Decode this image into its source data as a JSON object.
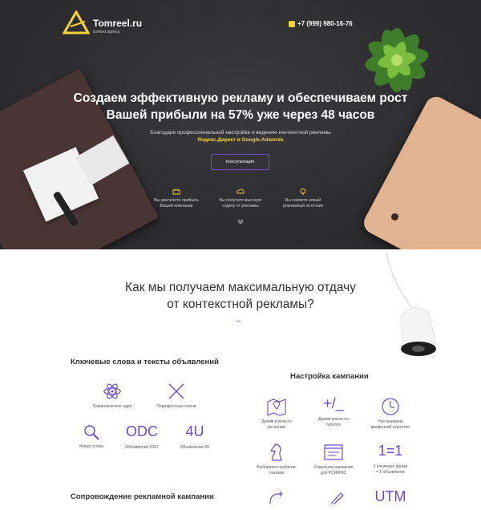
{
  "header": {
    "brand": "Tomreel.ru",
    "brand_sub": "context agency",
    "phone": "+7 (999) 980-16-76"
  },
  "hero": {
    "title_line1": "Создаем эффективную рекламу и обеспечиваем рост",
    "title_line2": "Вашей прибыли на 57% уже через 48 часов",
    "subtitle": "Благодаря профессиональной настройке и ведению контекстной рекламы",
    "subtitle_accent": "Яндекс.Директ и Google.Adwords",
    "cta_label": "Консультация",
    "features": [
      {
        "l1": "Вы увеличите прибыль",
        "l2": "Вашей компании"
      },
      {
        "l1": "Вы получите высокую",
        "l2": "отдачу от рекламы"
      },
      {
        "l1": "Вы освоите новый",
        "l2": "рекламный источник"
      }
    ]
  },
  "section": {
    "title_line1": "Как мы получаем максимальную отдачу",
    "title_line2": "от контекстной рекламы?",
    "tilde": "~"
  },
  "keywords": {
    "title": "Ключевые слова и тексты объявлений",
    "items": [
      {
        "label": "Семантическое ядро"
      },
      {
        "label": "Перекрестные ключи"
      },
      {
        "label": "Минус слова"
      },
      {
        "glyph": "ODC",
        "label": "Объявления ODC"
      },
      {
        "glyph": "4U",
        "label": "Объявления 4U"
      }
    ]
  },
  "campaign": {
    "title": "Настройка кампании",
    "items": [
      {
        "l1": "Делим ключи по",
        "l2": "регионам"
      },
      {
        "glyph": "+/_",
        "l1": "Делим ключи по",
        "l2": "теплоте"
      },
      {
        "l1": "Настраиваем",
        "l2": "временной таргетинг"
      },
      {
        "l1": "Выбираем стратегию",
        "l2": "показов"
      },
      {
        "l1": "Отдельная кампания",
        "l2": "для РСЯ/КМС"
      },
      {
        "glyph": "1=1",
        "l1": "1 ключевая фраза",
        "l2": "= 1 объявление"
      },
      {
        "glyph": "UTM"
      }
    ]
  },
  "support": {
    "title": "Сопровождение рекламной кампании"
  },
  "colors": {
    "accent": "#6b4bd0",
    "yellow": "#f3d337",
    "hero_bg": "#2f2f31"
  }
}
